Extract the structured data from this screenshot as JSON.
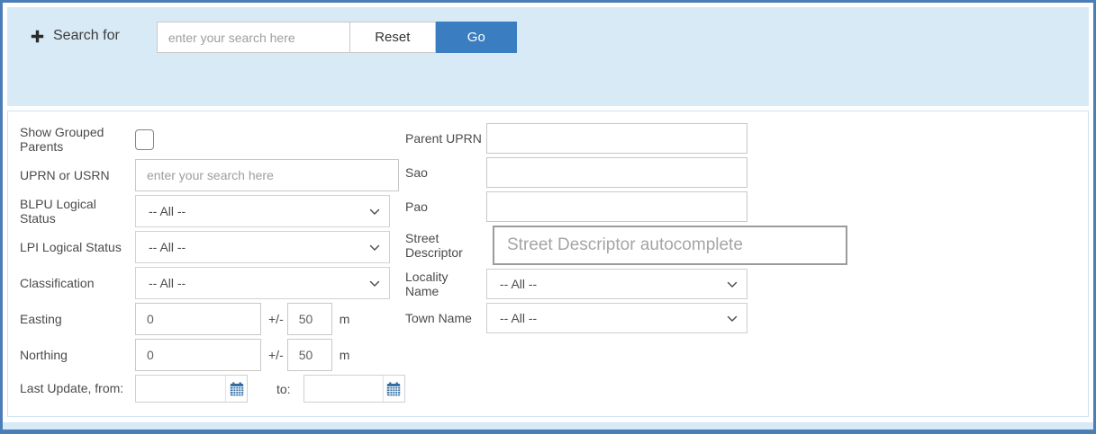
{
  "colors": {
    "accent_blue": "#3a7dc0",
    "panel_blue": "#d8eaf6",
    "frame_border": "#4b7db8",
    "calendar_icon_blue": "#2e6da4"
  },
  "search_bar": {
    "label": "Search for",
    "input_placeholder": "enter your search here",
    "reset_label": "Reset",
    "go_label": "Go"
  },
  "form": {
    "left": {
      "grouped_parents": {
        "label": "Show Grouped Parents"
      },
      "uprn_usrn": {
        "label": "UPRN or USRN",
        "placeholder": "enter your search here"
      },
      "blpu_status": {
        "label": "BLPU Logical Status",
        "value": "-- All --"
      },
      "lpi_status": {
        "label": "LPI Logical Status",
        "value": "-- All --"
      },
      "classification": {
        "label": "Classification",
        "value": "-- All --"
      },
      "easting": {
        "label": "Easting",
        "value": "0",
        "pm": "+/-",
        "tolerance": "50",
        "unit": "m"
      },
      "northing": {
        "label": "Northing",
        "value": "0",
        "pm": "+/-",
        "tolerance": "50",
        "unit": "m"
      },
      "last_update": {
        "label": "Last Update, from:",
        "to_label": "to:"
      }
    },
    "right": {
      "parent_uprn": {
        "label": "Parent UPRN"
      },
      "sao": {
        "label": "Sao"
      },
      "pao": {
        "label": "Pao"
      },
      "street_descriptor": {
        "label": "Street Descriptor",
        "placeholder": "Street Descriptor autocomplete"
      },
      "locality_name": {
        "label": "Locality Name",
        "value": "-- All --"
      },
      "town_name": {
        "label": "Town Name",
        "value": "-- All --"
      }
    }
  }
}
